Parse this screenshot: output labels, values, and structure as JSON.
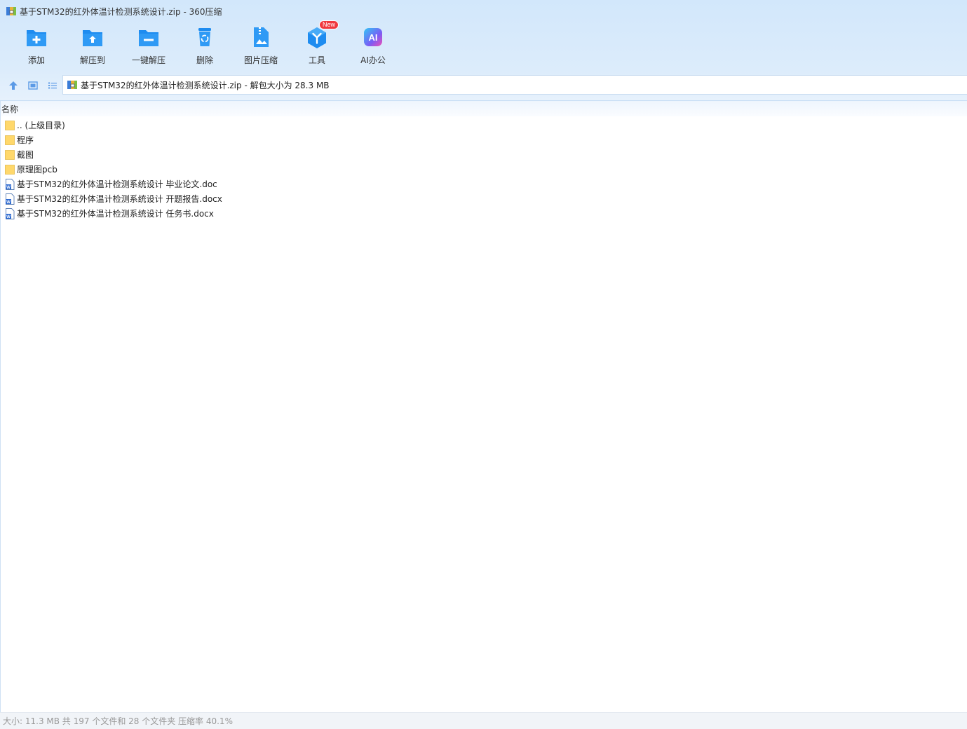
{
  "window": {
    "title": "基于STM32的红外体温计检测系统设计.zip - 360压缩",
    "icon": "zip-archive-icon"
  },
  "toolbar": {
    "items": [
      {
        "label": "添加",
        "icon": "add-folder-icon"
      },
      {
        "label": "解压到",
        "icon": "extract-to-icon"
      },
      {
        "label": "一键解压",
        "icon": "one-click-extract-icon"
      },
      {
        "label": "删除",
        "icon": "recycle-bin-icon"
      },
      {
        "label": "图片压缩",
        "icon": "image-compress-icon"
      },
      {
        "label": "工具",
        "icon": "tools-cube-icon",
        "badge": "New"
      },
      {
        "label": "AI办公",
        "icon": "ai-office-icon"
      }
    ]
  },
  "address": {
    "text": "基于STM32的红外体温计检测系统设计.zip - 解包大小为 28.3 MB"
  },
  "list": {
    "column_name": "名称",
    "items": [
      {
        "name": ".. (上级目录)",
        "type": "folder"
      },
      {
        "name": "程序",
        "type": "folder"
      },
      {
        "name": "截图",
        "type": "folder"
      },
      {
        "name": "原理图pcb",
        "type": "folder"
      },
      {
        "name": "基于STM32的红外体温计检测系统设计 毕业论文.doc",
        "type": "doc"
      },
      {
        "name": "基于STM32的红外体温计检测系统设计 开题报告.docx",
        "type": "docx"
      },
      {
        "name": "基于STM32的红外体温计检测系统设计 任务书.docx",
        "type": "docx"
      }
    ]
  },
  "status": {
    "text": "大小: 11.3 MB 共 197 个文件和 28 个文件夹 压缩率 40.1%"
  },
  "colors": {
    "accent": "#1e8cf0",
    "header_bg": "#d6e9fb",
    "badge_red": "#f0383e",
    "folder_yellow": "#ffd86b"
  }
}
